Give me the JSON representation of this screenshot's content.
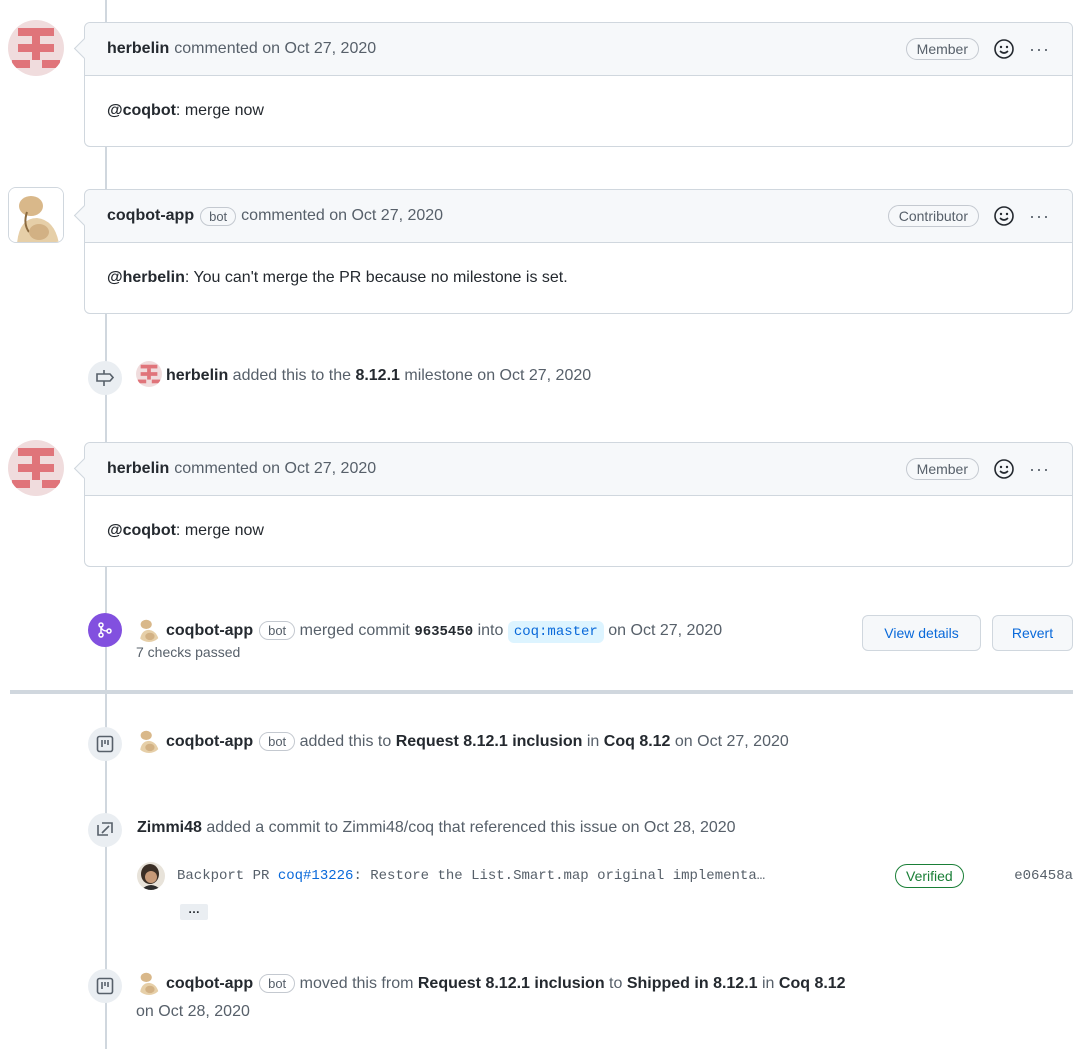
{
  "comments": [
    {
      "author": "herbelin",
      "meta": "commented on Oct 27, 2020",
      "role": "Member",
      "mention": "@coqbot",
      "body": ": merge now"
    },
    {
      "author": "coqbot-app",
      "bot_label": "bot",
      "meta": "commented on Oct 27, 2020",
      "role": "Contributor",
      "mention": "@herbelin",
      "body": ": You can't merge the PR because no milestone is set."
    },
    {
      "author": "herbelin",
      "meta": "commented on Oct 27, 2020",
      "role": "Member",
      "mention": "@coqbot",
      "body": ": merge now"
    }
  ],
  "more_label": "···",
  "milestone_event": {
    "actor": "herbelin",
    "text1": " added this to the ",
    "milestone": "8.12.1",
    "text2": " milestone on Oct 27, 2020"
  },
  "merge_event": {
    "actor": "coqbot-app",
    "bot_label": "bot",
    "text1": " merged commit ",
    "sha": "9635450",
    "text2": " into ",
    "branch": "coq:master",
    "text3": " on Oct 27, 2020",
    "checks": "7 checks passed",
    "view_details": "View details",
    "revert": "Revert"
  },
  "project_event": {
    "actor": "coqbot-app",
    "bot_label": "bot",
    "text1": " added this to ",
    "column": "Request 8.12.1 inclusion",
    "text2": " in ",
    "project": "Coq 8.12",
    "text3": " on Oct 27, 2020"
  },
  "reference_event": {
    "actor": "Zimmi48",
    "text": " added a commit to Zimmi48/coq that referenced this issue on Oct 28, 2020",
    "commit_prefix": "Backport PR ",
    "commit_link": "coq#13226",
    "commit_suffix": ": Restore the List.Smart.map original implementa…",
    "verified": "Verified",
    "sha": "e06458a",
    "ellipsis": "…"
  },
  "move_event": {
    "actor": "coqbot-app",
    "bot_label": "bot",
    "text1": " moved this from ",
    "from": "Request 8.12.1 inclusion",
    "text2": " to ",
    "to": "Shipped in 8.12.1",
    "text3": " in ",
    "project": "Coq 8.12",
    "date": "on Oct 28, 2020"
  },
  "colors": {
    "merged": "#8250df",
    "link": "#0969da",
    "verified": "#1a7f37",
    "herbelin_avatar": "#e0747a"
  }
}
